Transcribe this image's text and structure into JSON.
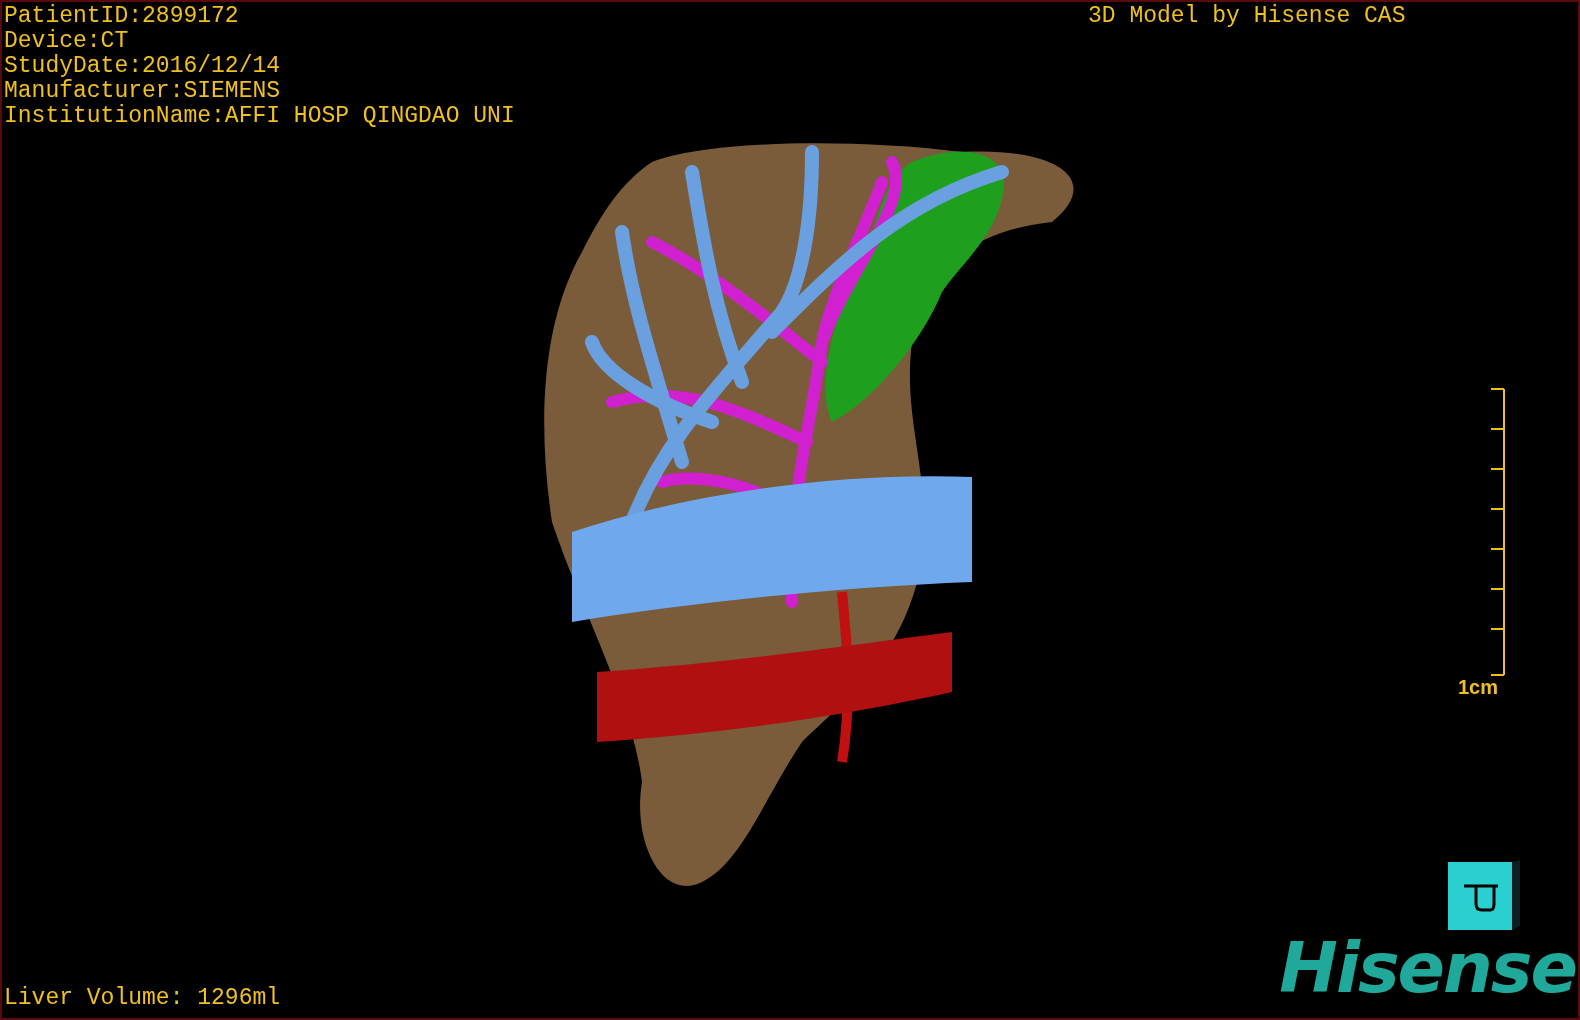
{
  "info_lines": [
    "PatientID:2899172",
    "Device:CT",
    "StudyDate:2016/12/14",
    "Manufacturer:SIEMENS",
    "InstitutionName:AFFI HOSP QINGDAO UNI"
  ],
  "top_right_title": "3D Model by Hisense CAS",
  "scale": {
    "label": "1cm"
  },
  "volume": "Liver Volume: 1296ml",
  "logo": "Hisense"
}
